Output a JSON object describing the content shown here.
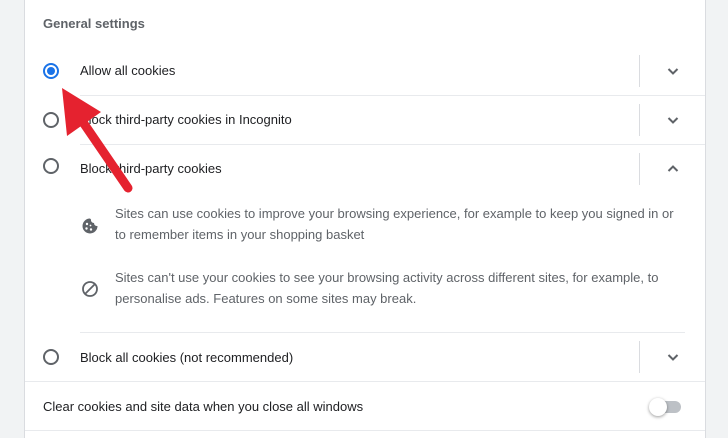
{
  "section": {
    "title": "General settings"
  },
  "options": [
    {
      "label": "Allow all cookies",
      "selected": true
    },
    {
      "label": "Block third-party cookies in Incognito",
      "selected": false
    },
    {
      "label": "Block third-party cookies",
      "selected": false,
      "expanded": true
    },
    {
      "label": "Block all cookies (not recommended)",
      "selected": false
    }
  ],
  "details": [
    {
      "icon": "cookie-icon",
      "text": "Sites can use cookies to improve your browsing experience, for example to keep you signed in or to remember items in your shopping basket"
    },
    {
      "icon": "block-icon",
      "text": "Sites can't use your cookies to see your browsing activity across different sites, for example, to personalise ads. Features on some sites may break."
    }
  ],
  "clear_on_exit": {
    "label": "Clear cookies and site data when you close all windows",
    "enabled": false
  },
  "colors": {
    "accent": "#1a73e8",
    "annotation_arrow": "#e5222f"
  }
}
